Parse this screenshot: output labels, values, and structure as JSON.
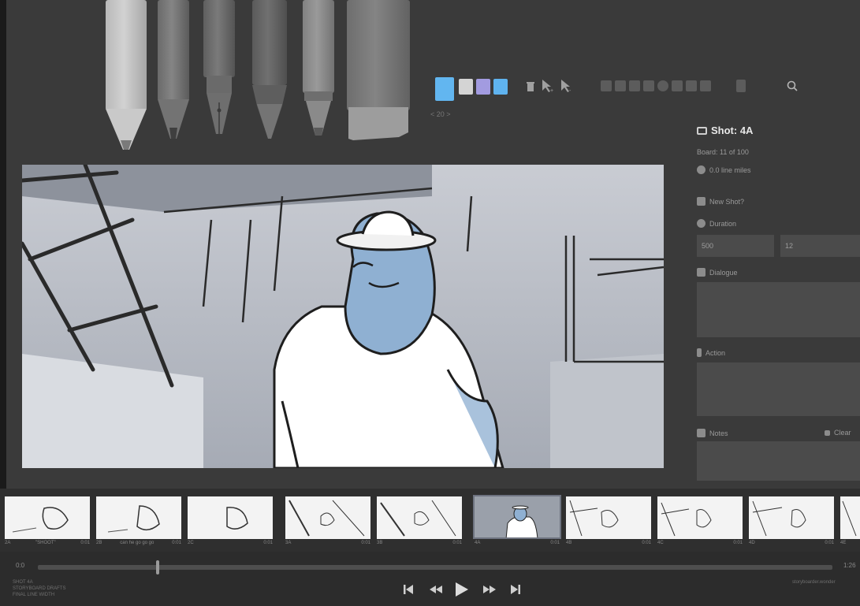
{
  "toolbar": {
    "brush_size_label": "< 20 >",
    "colors": [
      "#62b6f0",
      "#d4d4d4",
      "#a29be0",
      "#5fb3ef"
    ]
  },
  "shot_panel": {
    "title": "Shot: 4A",
    "board_info": "Board: 11 of 100",
    "line_miles": "0.0 line miles",
    "new_shot_label": "New Shot?",
    "duration_label": "Duration",
    "duration_ms": "500",
    "duration_frames": "12",
    "dialogue_label": "Dialogue",
    "action_label": "Action",
    "notes_label": "Notes",
    "notes_action": "Clear"
  },
  "timeline": {
    "start_time": "0:0",
    "end_time": "1:26",
    "meta_line1": "SHOT 4A",
    "meta_line2": "STORYBOARD DRAFTS",
    "meta_line3": "FINAL LINE WIDTH",
    "right_caption": "storyboarder.wonder"
  },
  "thumbnails": [
    {
      "num": "2A",
      "caption": "\"SHOOT\"",
      "dur": "0:01"
    },
    {
      "num": "2B",
      "caption": "can he go go go",
      "dur": "0:01"
    },
    {
      "num": "2C",
      "caption": "",
      "dur": "0:01"
    },
    {
      "num": "3A",
      "caption": "",
      "dur": "0:01"
    },
    {
      "num": "3B",
      "caption": "",
      "dur": "0:01"
    },
    {
      "num": "4A",
      "caption": "",
      "dur": "0:01"
    },
    {
      "num": "4B",
      "caption": "",
      "dur": "0:01"
    },
    {
      "num": "4C",
      "caption": "",
      "dur": "0:01"
    },
    {
      "num": "4D",
      "caption": "",
      "dur": "0:01"
    },
    {
      "num": "4E",
      "caption": "",
      "dur": ""
    }
  ],
  "icons": {
    "trash": "trash-icon",
    "pointer_add": "pointer-add-icon",
    "pointer_sub": "pointer-subtract-icon",
    "search": "search-icon"
  }
}
